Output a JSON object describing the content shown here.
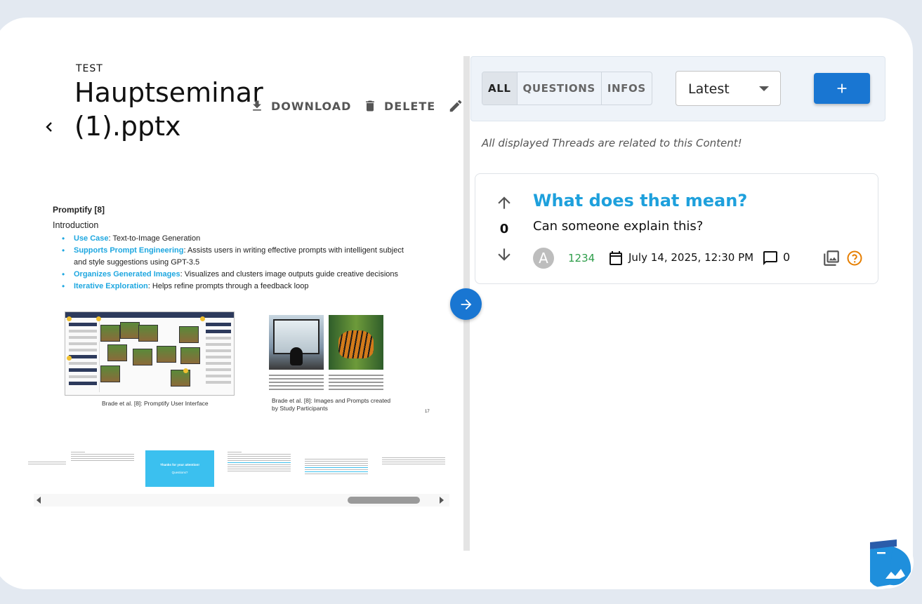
{
  "document": {
    "eyebrow": "TEST",
    "title": "Hauptseminar (1).pptx",
    "actions": {
      "download": "DOWNLOAD",
      "delete": "DELETE"
    }
  },
  "slide": {
    "title": "Promptify [8]",
    "subtitle": "Introduction",
    "bullets": [
      {
        "term": "Use Case",
        "text": ": Text-to-Image Generation"
      },
      {
        "term": "Supports Prompt Engineering",
        "text": ": Assists users in writing effective prompts with intelligent subject and style suggestions using GPT-3.5"
      },
      {
        "term": "Organizes Generated Images",
        "text": ": Visualizes and clusters image outputs guide creative decisions"
      },
      {
        "term": "Iterative Exploration",
        "text": ": Helps refine prompts through a feedback loop"
      }
    ],
    "caption_left": "Brade et al. [8]: Promptify User Interface",
    "caption_right": "Brade et al. [8]: Images and Prompts created by Study Participants",
    "page_number": "17"
  },
  "thumbnails": {
    "active_line1": "Thanks for your attention!",
    "active_line2": "Questions?"
  },
  "filters": [
    {
      "label": "ALL",
      "selected": true
    },
    {
      "label": "QUESTIONS",
      "selected": false
    },
    {
      "label": "INFOS",
      "selected": false
    }
  ],
  "sort": {
    "value": "Latest"
  },
  "note": "All displayed Threads are related to this Content!",
  "thread": {
    "votes": "0",
    "title": "What does that mean?",
    "body": "Can someone explain this?",
    "avatar_letter": "A",
    "score": "1234",
    "date": "July 14, 2025, 12:30 PM",
    "comments": "0"
  },
  "colors": {
    "primary": "#1976d2",
    "thread_title": "#1ea0dc",
    "score": "#2e9d4a",
    "question_icon": "#e67e00",
    "page_bg": "#e3e9f1"
  }
}
